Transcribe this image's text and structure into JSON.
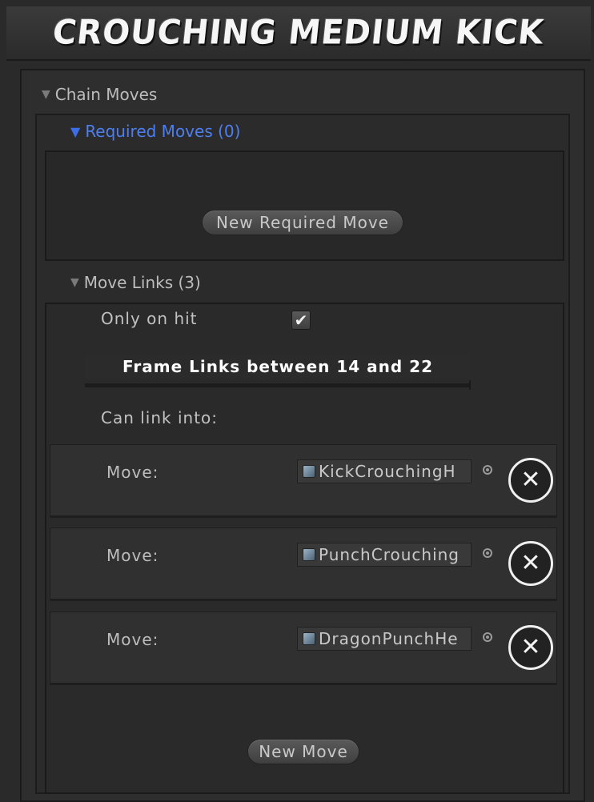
{
  "header": {
    "title": "CROUCHING MEDIUM KICK"
  },
  "chain_moves": {
    "label": "Chain Moves",
    "required_moves": {
      "label": "Required Moves (0)",
      "new_button": "New Required Move"
    },
    "move_links": {
      "label": "Move Links (3)",
      "only_on_hit_label": "Only on hit",
      "only_on_hit_checked": true,
      "check_glyph": "✔",
      "frame_links_text": "Frame Links between 14 and 22",
      "frame_min": 14,
      "frame_max": 22,
      "can_link_label": "Can link into:",
      "moves": [
        {
          "label": "Move:",
          "value": "KickCrouchingH",
          "remove_glyph": "✕"
        },
        {
          "label": "Move:",
          "value": "PunchCrouching",
          "remove_glyph": "✕"
        },
        {
          "label": "Move:",
          "value": "DragonPunchHe",
          "remove_glyph": "✕"
        }
      ],
      "new_button": "New Move"
    }
  },
  "icons": {
    "foldout": "triangle-down-icon",
    "object": "object-icon",
    "picker": "object-picker-icon",
    "remove": "close-circle-icon"
  },
  "colors": {
    "accent_blue": "#4d7ff0",
    "slider_fill": "#1b2a52"
  }
}
